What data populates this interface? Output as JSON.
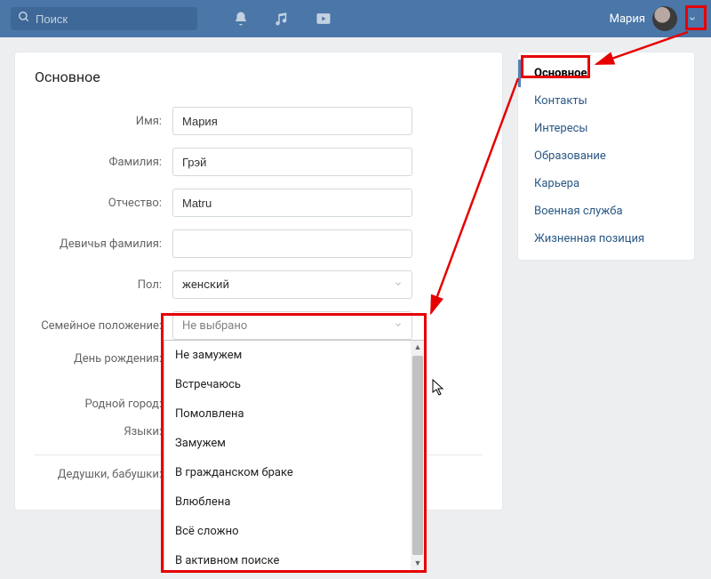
{
  "topbar": {
    "search_placeholder": "Поиск",
    "username": "Мария"
  },
  "main": {
    "title": "Основное",
    "fields": {
      "name_label": "Имя:",
      "name_value": "Мария",
      "surname_label": "Фамилия:",
      "surname_value": "Грэй",
      "patronymic_label": "Отчество:",
      "patronymic_value": "Matru",
      "maiden_label": "Девичья фамилия:",
      "maiden_value": "",
      "gender_label": "Пол:",
      "gender_value": "женский",
      "relationship_label": "Семейное положение:",
      "relationship_value": "Не выбрано",
      "birthday_label": "День рождения:",
      "hometown_label": "Родной город:",
      "languages_label": "Языки:",
      "grandparents_label": "Дедушки, бабушки:"
    }
  },
  "relationship_options": [
    "Не замужем",
    "Встречаюсь",
    "Помолвлена",
    "Замужем",
    "В гражданском браке",
    "Влюблена",
    "Всё сложно",
    "В активном поиске"
  ],
  "sidebar": {
    "items": [
      "Основное",
      "Контакты",
      "Интересы",
      "Образование",
      "Карьера",
      "Военная служба",
      "Жизненная позиция"
    ]
  }
}
